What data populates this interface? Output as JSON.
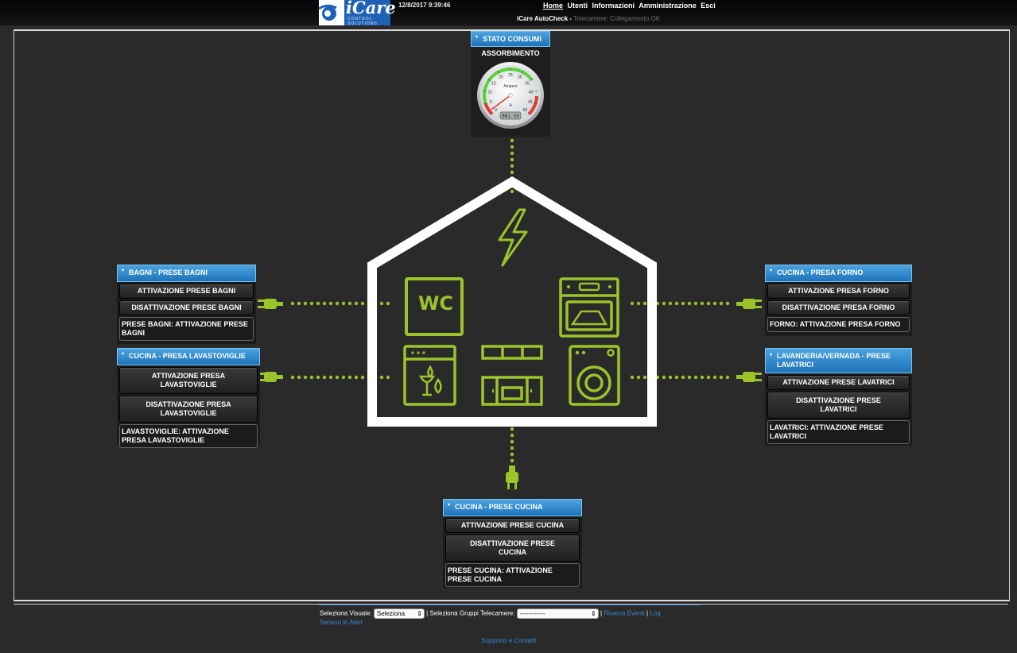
{
  "header": {
    "logo_text": "iCare",
    "logo_sub": "CONTROL SOLUTIONS",
    "datetime": "12/8/2017 9:39:46",
    "nav": [
      "Home",
      "Utenti",
      "Informazioni",
      "Amministrazione",
      "Esci"
    ],
    "status_title": "iCare AutoCheck -",
    "status_text": "Telecamere: Collegamento OK"
  },
  "gauge": {
    "panel_title": "STATO CONSUMI",
    "label": "ASSORBIMENTO",
    "unit": "Ampere",
    "unit_short": "A",
    "value": 1.55,
    "readout": "001.55",
    "ticks": [
      "0",
      "5",
      "10",
      "15",
      "20",
      "25",
      "30",
      "35",
      "40",
      "45",
      "50"
    ],
    "max": 50
  },
  "panels": {
    "bagni": {
      "title": "BAGNI - PRESE BAGNI",
      "on": "ATTIVAZIONE PRESE BAGNI",
      "off": "DISATTIVAZIONE PRESE BAGNI",
      "status": "PRESE BAGNI: ATTIVAZIONE PRESE BAGNI"
    },
    "lavastoviglie": {
      "title": "CUCINA - PRESA LAVASTOVIGLIE",
      "on": "ATTIVAZIONE PRESA LAVASTOVIGLIE",
      "off": "DISATTIVAZIONE PRESA LAVASTOVIGLIE",
      "status": "LAVASTOVIGLIE: ATTIVAZIONE PRESA LAVASTOVIGLIE"
    },
    "forno": {
      "title": "CUCINA - PRESA FORNO",
      "on": "ATTIVAZIONE PRESA FORNO",
      "off": "DISATTIVAZIONE PRESA FORNO",
      "status": "FORNO: ATTIVAZIONE PRESA FORNO"
    },
    "lavatrici": {
      "title": "LAVANDERIA/VERNADA - PRESE LAVATRICI",
      "on": "ATTIVAZIONE PRESE LAVATRICI",
      "off": "DISATTIVAZIONE PRESE LAVATRICI",
      "status": "LAVATRICI: ATTIVAZIONE PRESE LAVATRICI"
    },
    "cucina": {
      "title": "CUCINA - PRESE CUCINA",
      "on": "ATTIVAZIONE PRESE CUCINA",
      "off": "DISATTIVAZIONE PRESE CUCINA",
      "status": "PRESE CUCINA: ATTIVAZIONE PRESE CUCINA"
    }
  },
  "house": {
    "wc_label": "WC",
    "accent": "#9cc42a"
  },
  "footer": {
    "visual_label": "Seleziona Visuale:",
    "visual_value": "Seleziona",
    "groups_label": "| Seleziona Gruppi Telecamere:",
    "groups_value": "------------",
    "events_link": "Ricerca Eventi",
    "log_link": "Log",
    "alert_link": "Sensori in Alert",
    "support_link": "Supporto e Contatti"
  }
}
